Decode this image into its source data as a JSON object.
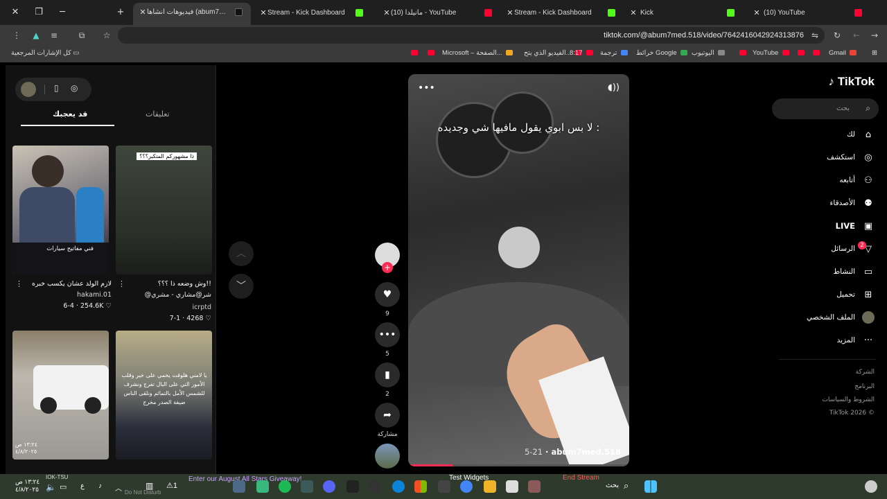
{
  "browser": {
    "tabs": [
      {
        "title": "فيديوهات أنشأها (abum7med.518)",
        "favicon": "tiktok-icon",
        "active": true
      },
      {
        "title": "Stream - Kick Dashboard",
        "favicon": "kick-icon"
      },
      {
        "title": "(10) مانيلدا - YouTube",
        "favicon": "youtube-icon"
      },
      {
        "title": "Stream - Kick Dashboard",
        "favicon": "kick-icon"
      },
      {
        "title": "Kick",
        "favicon": "kick-icon"
      },
      {
        "title": "(10) YouTube",
        "favicon": "youtube-icon"
      }
    ],
    "url": "tiktok.com/@abum7med.518/video/7642416042924313876",
    "bookmarks": {
      "all_bookmarks": "كل الإشارات المرجعية",
      "items": [
        "Microsoft – الصفحة...",
        "الفيديو الذي يتح...",
        "8:17",
        "ترجمة",
        "خرائط Google",
        "اليوتيوب",
        "YouTube",
        "Gmail"
      ]
    }
  },
  "tiktok": {
    "logo": "TikTok",
    "search_placeholder": "بحث",
    "nav": [
      {
        "label": "لك",
        "icon": "home-icon"
      },
      {
        "label": "استكشف",
        "icon": "compass-icon"
      },
      {
        "label": "أتابعه",
        "icon": "following-icon"
      },
      {
        "label": "الأصدقاء",
        "icon": "friends-icon"
      },
      {
        "label": "LIVE",
        "icon": "live-icon"
      },
      {
        "label": "الرسائل",
        "icon": "messages-icon",
        "badge": "2"
      },
      {
        "label": "النشاط",
        "icon": "activity-icon"
      },
      {
        "label": "تحميل",
        "icon": "upload-icon"
      },
      {
        "label": "الملف الشخصي",
        "icon": "profile-avatar-icon"
      },
      {
        "label": "المزيد",
        "icon": "more-icon"
      }
    ],
    "footer": [
      "الشركة",
      "البرنامج",
      "الشروط والسياسات",
      "TikTok 2026 ©"
    ],
    "side_tabs": {
      "comments": "تعليقات",
      "you_may_like": "قد يعجبك"
    },
    "suggested": [
      {
        "caption": "لازم الولد عشان يكسب خبره",
        "author": "hakami.01",
        "likes": "254.6K",
        "date": "6-4",
        "overlay": "فني مفاتيح سيارات"
      },
      {
        "caption": "وش وضعه ذا ؟؟؟!!",
        "author": "@شر@مشاري - مشري",
        "extra": "icrptd",
        "likes": "4268",
        "date": "7-1",
        "overlay": "ذا مشهوركم المتكبر؟؟؟"
      },
      {
        "overlay_date": "١٣:٢٤ ص ٤/٨/٢٠٢٥"
      },
      {
        "overlay": "يا لامني هلوقت يخمي على خير وقلب الأمور التي على البال تفرج ونشرف للشمس الأمل بالتمائم ونلقى الناس ضيقة الصدر مخرج"
      }
    ],
    "video": {
      "caption": "لا بس ابوي يقول مافيها شي وجديده :",
      "author": "abum7med.518",
      "date": "5-21",
      "progress": 0.2
    },
    "actions": {
      "likes": "9",
      "comments": "5",
      "saves": "2",
      "share": "مشاركة"
    }
  },
  "taskbar": {
    "weather": "IOK-TSU",
    "promo": "Enter our August All Stars Giveaway!",
    "test_widgets": "Test Widgets",
    "end_stream": "End Stream",
    "search": "بحث",
    "time": "١٣:٢٤ ص",
    "date": "٤/٨/٢٠٢٥",
    "lang": "ع",
    "dnd": "Do Not Disturb",
    "alert_count": "1"
  }
}
